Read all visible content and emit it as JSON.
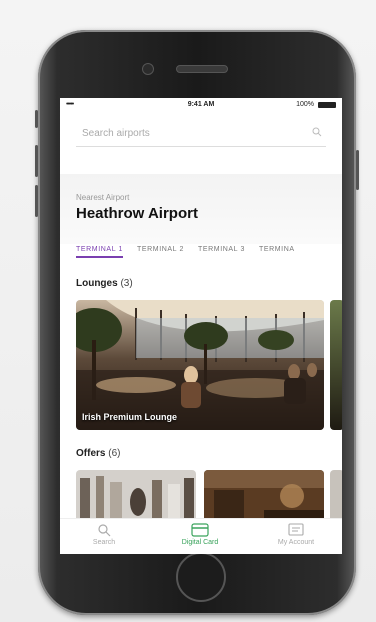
{
  "status_bar": {
    "signal": "•••••",
    "time": "9:41 AM",
    "battery": "100%"
  },
  "search": {
    "placeholder": "Search airports"
  },
  "header": {
    "nearest_label": "Nearest Airport",
    "airport_name": "Heathrow Airport"
  },
  "terminal_tabs": [
    {
      "label": "TERMINAL 1",
      "active": true
    },
    {
      "label": "TERMINAL 2"
    },
    {
      "label": "TERMINAL 3"
    },
    {
      "label": "TERMINA"
    }
  ],
  "lounges": {
    "title": "Lounges",
    "count": "(3)",
    "cards": [
      {
        "label": "Irish Premium  Lounge"
      }
    ]
  },
  "offers": {
    "title": "Offers",
    "count": "(6)"
  },
  "bottom_nav": [
    {
      "label": "Search",
      "icon": "search-icon"
    },
    {
      "label": "Digital Card",
      "icon": "card-icon",
      "active": true
    },
    {
      "label": "My Account",
      "icon": "account-icon"
    }
  ],
  "colors": {
    "accent": "#7a3fb0",
    "nav_active": "#3aa35c"
  }
}
